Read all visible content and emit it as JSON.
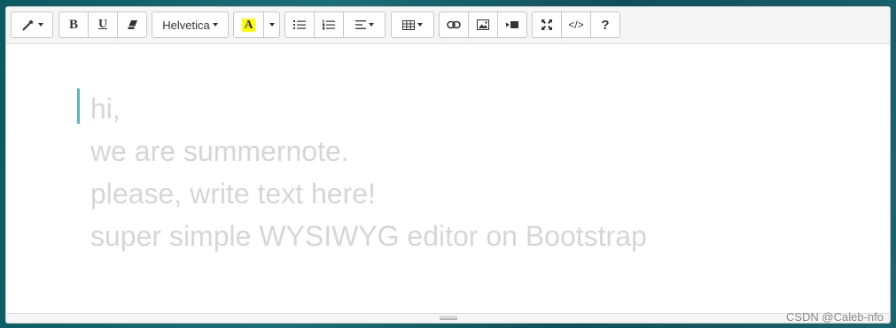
{
  "toolbar": {
    "style_icon": "magic-wand-icon",
    "bold_label": "B",
    "underline_label": "U",
    "eraser_icon": "eraser-icon",
    "font_name": "Helvetica",
    "color_label": "A",
    "unordered_list_icon": "unordered-list-icon",
    "ordered_list_icon": "ordered-list-icon",
    "paragraph_icon": "align-left-icon",
    "table_icon": "table-icon",
    "link_icon": "link-icon",
    "picture_icon": "picture-icon",
    "video_icon": "video-icon",
    "fullscreen_icon": "fullscreen-icon",
    "codeview_label": "</>",
    "help_label": "?"
  },
  "editor": {
    "lines": [
      "hi,",
      "we are summernote.",
      "please, write text here!",
      "super simple WYSIWYG editor on Bootstrap"
    ]
  },
  "watermark": "CSDN @Caleb-nfo",
  "colors": {
    "highlight": "#ffff00",
    "cursor": "#5ab7c7",
    "placeholder_text": "#d6d6d6"
  }
}
